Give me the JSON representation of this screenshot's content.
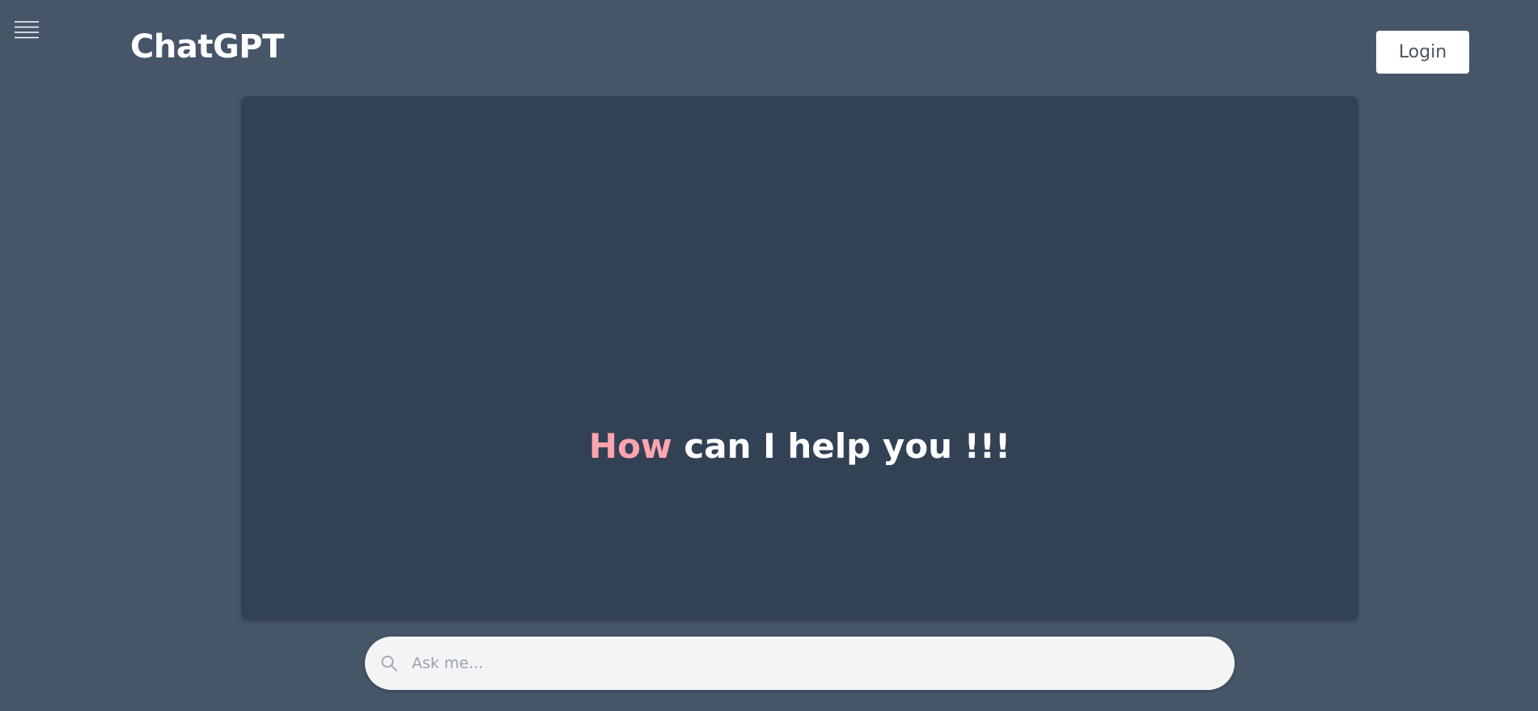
{
  "header": {
    "brand_title": "ChatGPT",
    "menu_icon": "hamburger-menu-icon",
    "login_label": "Login"
  },
  "main": {
    "greeting_accent": "How",
    "greeting_rest": "can I help you !!!"
  },
  "search": {
    "icon": "search-icon",
    "placeholder": "Ask me...",
    "value": ""
  },
  "colors": {
    "page_background": "#475569",
    "panel_background": "#334155",
    "accent": "#fda4af",
    "text_primary": "#ffffff",
    "input_background": "#f3f4f6"
  }
}
